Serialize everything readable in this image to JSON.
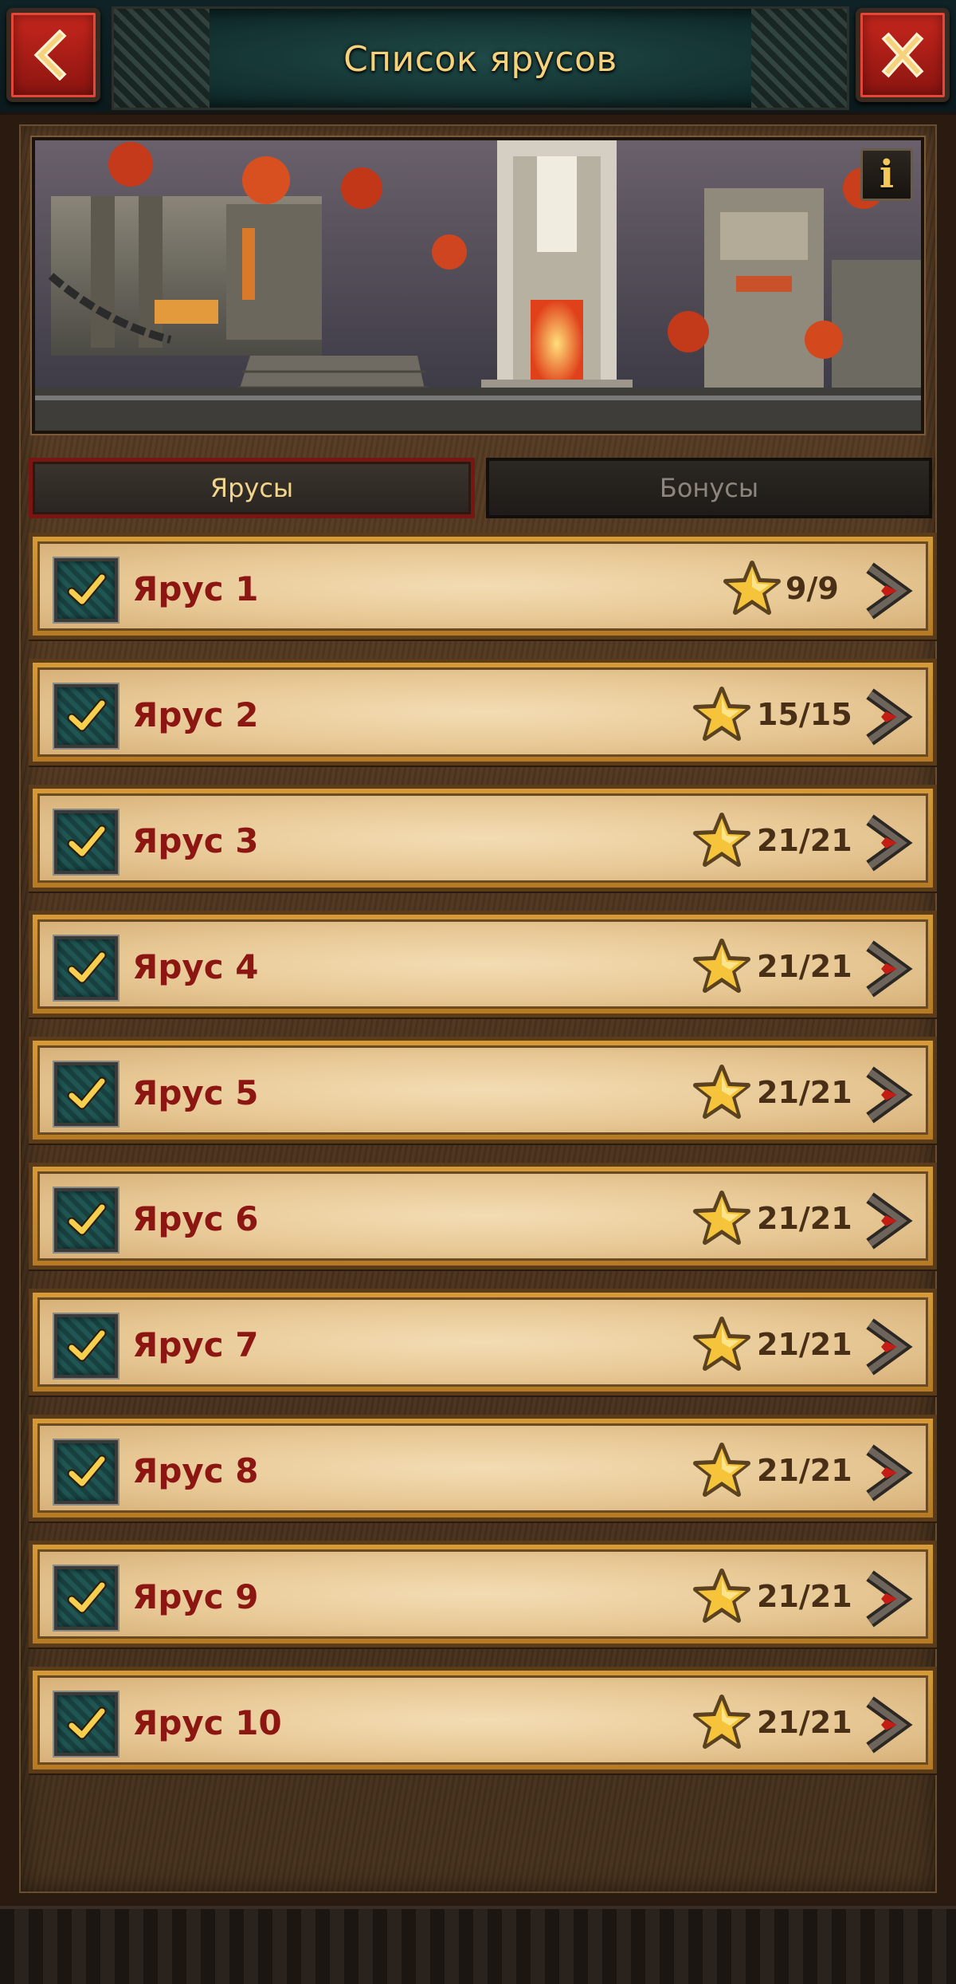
{
  "header": {
    "title": "Список ярусов",
    "back_icon": "chevron-left-icon",
    "close_icon": "close-x-icon"
  },
  "banner": {
    "info_label": "i"
  },
  "tabs": [
    {
      "label": "Ярусы",
      "active": true
    },
    {
      "label": "Бонусы",
      "active": false
    }
  ],
  "tiers": [
    {
      "name": "Ярус 1",
      "score": "9/9",
      "completed": true
    },
    {
      "name": "Ярус 2",
      "score": "15/15",
      "completed": true
    },
    {
      "name": "Ярус 3",
      "score": "21/21",
      "completed": true
    },
    {
      "name": "Ярус 4",
      "score": "21/21",
      "completed": true
    },
    {
      "name": "Ярус 5",
      "score": "21/21",
      "completed": true
    },
    {
      "name": "Ярус 6",
      "score": "21/21",
      "completed": true
    },
    {
      "name": "Ярус 7",
      "score": "21/21",
      "completed": true
    },
    {
      "name": "Ярус 8",
      "score": "21/21",
      "completed": true
    },
    {
      "name": "Ярус 9",
      "score": "21/21",
      "completed": true
    },
    {
      "name": "Ярус 10",
      "score": "21/21",
      "completed": true
    }
  ],
  "colors": {
    "accent_red": "#c8271d",
    "title_gold": "#f6d27c",
    "tier_name": "#8c1712",
    "parchment": "#e8c996"
  }
}
